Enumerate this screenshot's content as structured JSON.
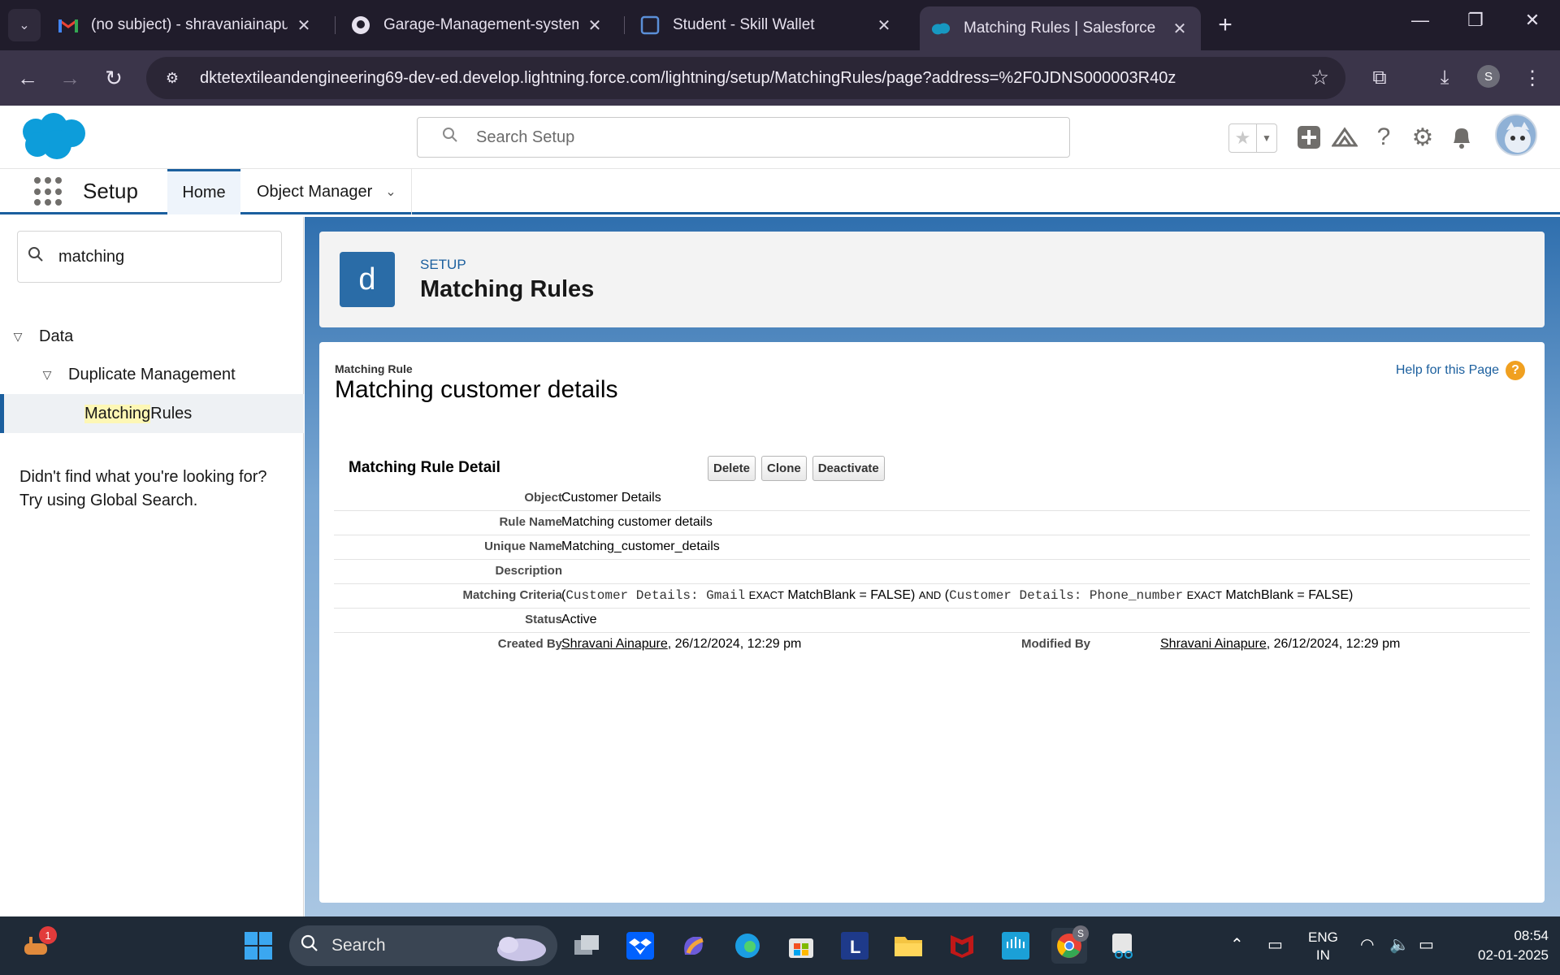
{
  "browser": {
    "tabs": [
      {
        "title": "(no subject) - shravaniainapure@",
        "icon": "gmail-icon"
      },
      {
        "title": "Garage-Management-system/R",
        "icon": "github-icon"
      },
      {
        "title": "Student - Skill Wallet",
        "icon": "skillwallet-icon"
      },
      {
        "title": "Matching Rules | Salesforce",
        "icon": "salesforce-icon",
        "active": true
      }
    ],
    "url": "dktetextileandengineering69-dev-ed.develop.lightning.force.com/lightning/setup/MatchingRules/page?address=%2F0JDNS000003R40z",
    "profile_initial": "S"
  },
  "sf_header": {
    "search_placeholder": "Search Setup"
  },
  "setup_nav": {
    "app_title": "Setup",
    "tabs": [
      {
        "label": "Home"
      },
      {
        "label": "Object Manager"
      }
    ]
  },
  "left_panel": {
    "quick_find_value": "matching",
    "tree": [
      {
        "label": "Data"
      },
      {
        "label": "Duplicate Management"
      },
      {
        "label_highlight": "Matching",
        "label_rest": " Rules"
      }
    ],
    "not_found_line1": "Didn't find what you're looking for?",
    "not_found_line2": "Try using Global Search."
  },
  "page_header": {
    "icon_letter": "d",
    "eyebrow": "SETUP",
    "title": "Matching Rules"
  },
  "detail": {
    "entity_label": "Matching Rule",
    "entity_name": "Matching customer details",
    "help_link": "Help for this Page",
    "section_title": "Matching Rule Detail",
    "buttons": {
      "delete": "Delete",
      "clone": "Clone",
      "deactivate": "Deactivate"
    },
    "rows": {
      "object": {
        "label": "Object",
        "value": "Customer Details"
      },
      "rule_name": {
        "label": "Rule Name",
        "value": "Matching customer details"
      },
      "unique_name": {
        "label": "Unique Name",
        "value": "Matching_customer_details"
      },
      "description": {
        "label": "Description",
        "value": ""
      },
      "criteria": {
        "label": "Matching Criteria",
        "open1": "(",
        "field1": "Customer Details: Gmail",
        "op1": "EXACT",
        "tail1": "MatchBlank = FALSE)",
        "and": "AND",
        "open2": "(",
        "field2": "Customer Details: Phone_number",
        "op2": "EXACT",
        "tail2": "MatchBlank = FALSE)"
      },
      "status": {
        "label": "Status",
        "value": "Active"
      },
      "created": {
        "label": "Created By",
        "user": "Shravani Ainapure",
        "date": ", 26/12/2024, 12:29 pm"
      },
      "modified": {
        "label": "Modified By",
        "user": "Shravani Ainapure",
        "date": ", 26/12/2024, 12:29 pm"
      }
    }
  },
  "taskbar": {
    "search_label": "Search",
    "notification_count": "1",
    "lang_line1": "ENG",
    "lang_line2": "IN",
    "time": "08:54",
    "date": "02-01-2025",
    "chrome_badge": "S"
  }
}
